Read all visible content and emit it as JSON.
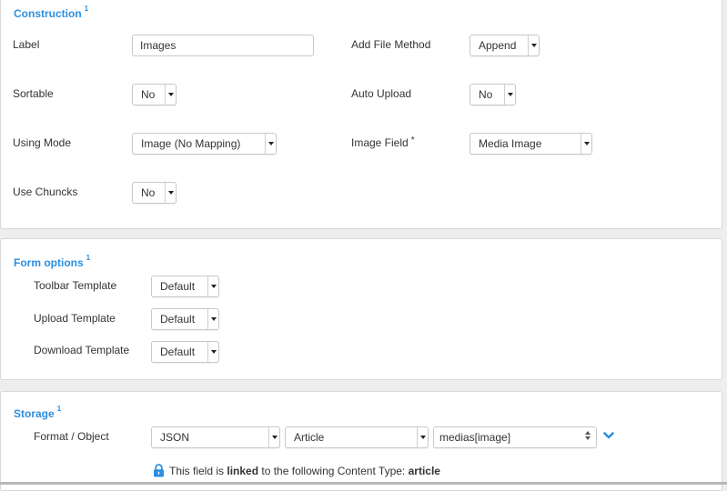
{
  "construction": {
    "title": "Construction",
    "title_sup": "1",
    "label_label": "Label",
    "label_value": "Images",
    "add_file_method_label": "Add File Method",
    "add_file_method_value": "Append",
    "sortable_label": "Sortable",
    "sortable_value": "No",
    "auto_upload_label": "Auto Upload",
    "auto_upload_value": "No",
    "using_mode_label": "Using Mode",
    "using_mode_value": "Image (No Mapping)",
    "image_field_label": "Image Field",
    "image_field_required": "*",
    "image_field_value": "Media Image",
    "use_chunks_label": "Use Chuncks",
    "use_chunks_value": "No"
  },
  "form_options": {
    "title": "Form options",
    "title_sup": "1",
    "toolbar_template_label": "Toolbar Template",
    "toolbar_template_value": "Default",
    "upload_template_label": "Upload Template",
    "upload_template_value": "Default",
    "download_template_label": "Download Template",
    "download_template_value": "Default"
  },
  "storage": {
    "title": "Storage",
    "title_sup": "1",
    "format_label": "Format / Object",
    "format_value": "JSON",
    "object_value": "Article",
    "field_value": "medias[image]",
    "linked_prefix": "This field is ",
    "linked_bold": "linked",
    "linked_middle": " to the following Content Type: ",
    "linked_type": "article"
  },
  "colors": {
    "accent": "#2d8fe0"
  },
  "icons": {
    "lock": "lock-icon",
    "chevron": "chevron-down-icon"
  }
}
